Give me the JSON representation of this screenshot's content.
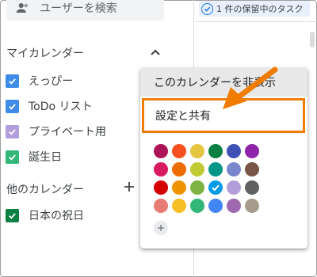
{
  "search": {
    "label": "ユーザーを検索",
    "icon": "people-icon"
  },
  "pending": {
    "text": "1 件の保留中のタスク",
    "icon": "check-circle-icon",
    "color": "#1a73e8"
  },
  "my_calendars": {
    "title": "マイカレンダー",
    "toggle_icon": "chevron-up-icon",
    "items": [
      {
        "label": "えっぴー",
        "color": "#3f8be8"
      },
      {
        "label": "ToDo リスト",
        "color": "#3f8be8"
      },
      {
        "label": "プライベート用",
        "color": "#b39ddb"
      },
      {
        "label": "誕生日",
        "color": "#33b679"
      }
    ]
  },
  "other_calendars": {
    "title": "他のカレンダー",
    "add_icon": "plus-icon",
    "items": [
      {
        "label": "日本の祝日",
        "color": "#0b8043"
      }
    ]
  },
  "menu": {
    "hide_label": "このカレンダーを非表示",
    "settings_label": "設定と共有",
    "highlight_color": "#f07c00",
    "selected_color": "#039be5",
    "colors": [
      "#ad1457",
      "#f4511e",
      "#e4c441",
      "#0b8043",
      "#3f51b5",
      "#8e24aa",
      "#d81b60",
      "#ef6c00",
      "#c0ca33",
      "#009688",
      "#7986cb",
      "#795548",
      "#d50000",
      "#f09300",
      "#7cb342",
      "#039be5",
      "#b39ddb",
      "#616161",
      "#e67c73",
      "#f6bf26",
      "#33b679",
      "#4285f4",
      "#9e69af",
      "#a79b8e"
    ],
    "add_color_icon": "plus-icon"
  }
}
